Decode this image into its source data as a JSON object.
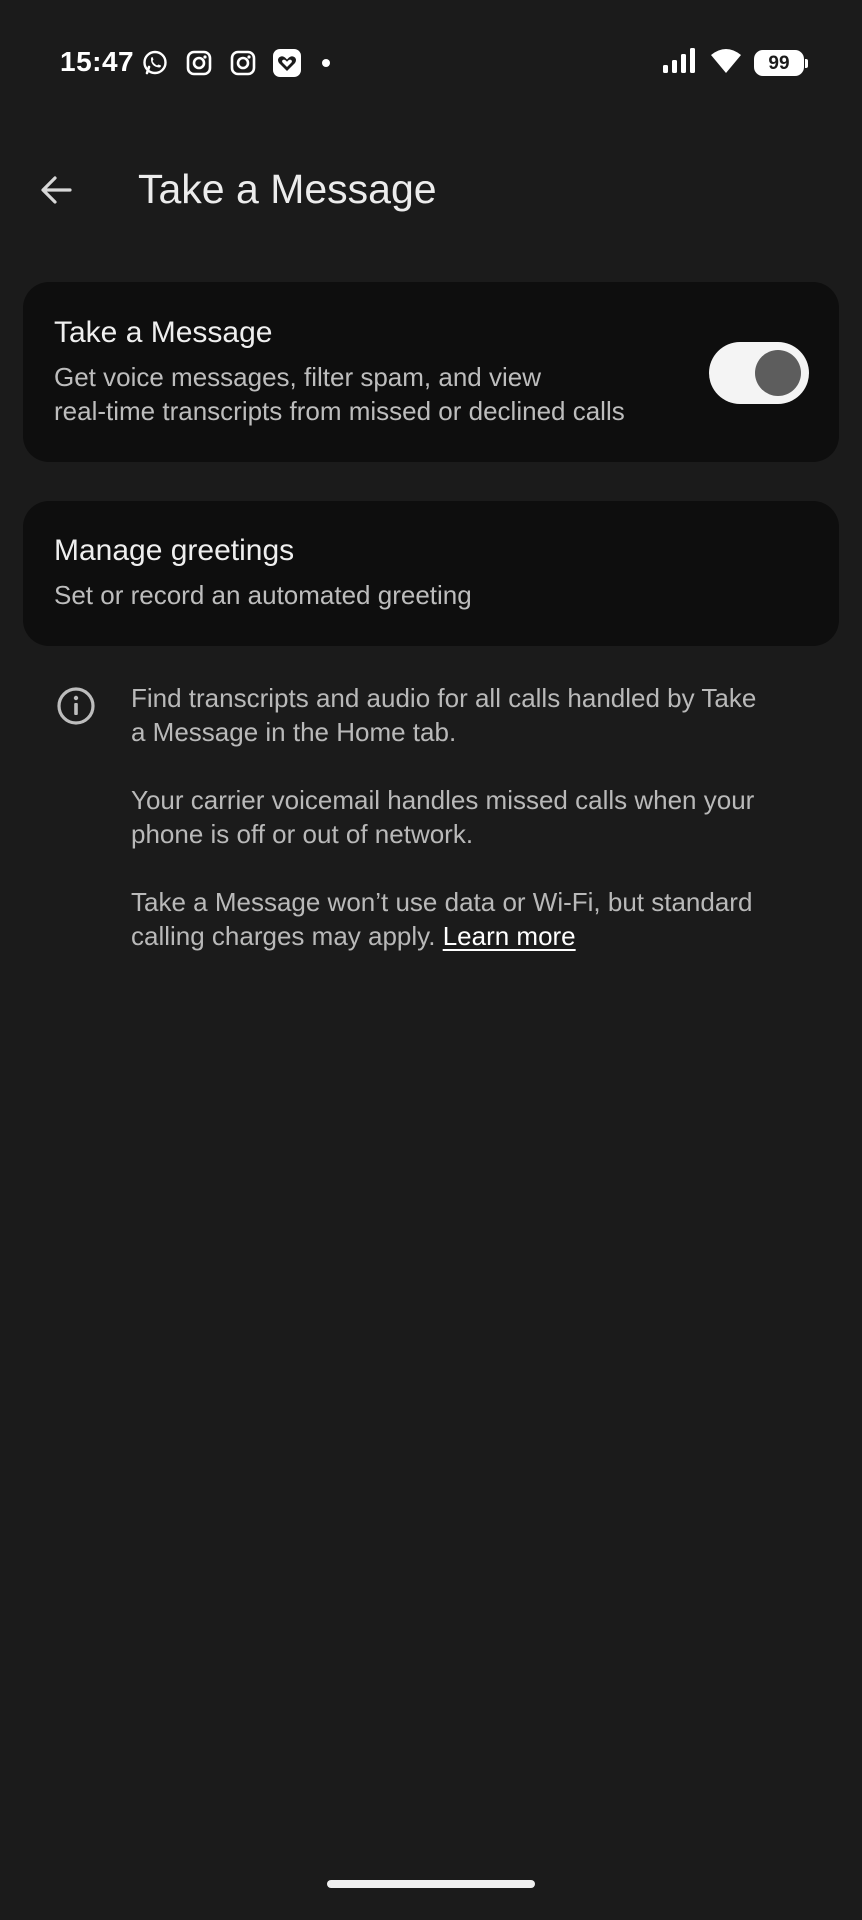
{
  "status_bar": {
    "time": "15:47",
    "left_icons": [
      "whatsapp-icon",
      "instagram-icon",
      "instagram-icon",
      "heart-app-icon",
      "notification-dot"
    ],
    "battery_level": "99",
    "right_icons": [
      "signal-icon",
      "wifi-icon",
      "battery-icon"
    ]
  },
  "app_bar": {
    "back_icon": "arrow-back-icon",
    "title": "Take a Message"
  },
  "take_message_card": {
    "title": "Take a Message",
    "subtitle_line1": "Get voice messages, filter spam, and view",
    "subtitle_line2": "real-time transcripts from missed or declined calls",
    "toggle_on": true
  },
  "greetings_card": {
    "title": "Manage greetings",
    "subtitle": "Set or record an automated greeting"
  },
  "info": {
    "icon": "info-icon",
    "paragraph1_line1": "Find transcripts and audio for all calls handled by Take",
    "paragraph1_line2": "a Message in the Home tab.",
    "paragraph2_line1": "Your carrier voicemail handles missed calls when your",
    "paragraph2_line2": "phone is off or out of network.",
    "paragraph3_line1": "Take a Message won’t use data or Wi-Fi, but standard",
    "paragraph3_line2": "calling charges may apply.",
    "learn_more": "Learn more"
  },
  "colors": {
    "background": "#1b1b1b",
    "card": "#0e0e0e",
    "toggle_track": "#f4f4f4",
    "toggle_thumb": "#5d5d5d"
  }
}
